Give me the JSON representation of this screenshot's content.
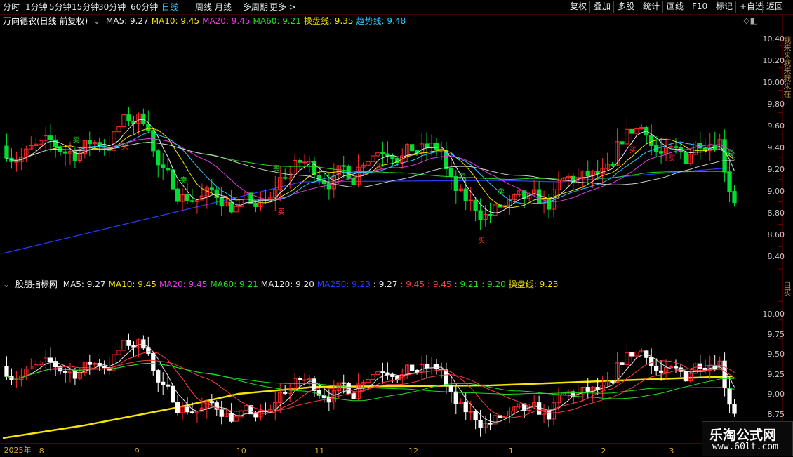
{
  "tabs": [
    "分时",
    "1分钟",
    "5分钟",
    "15分钟",
    "30分钟",
    "60分钟",
    "日线",
    "周线",
    "月线",
    "多周期",
    "更多 >"
  ],
  "active_tab": "日线",
  "right_buttons": [
    "复权",
    "叠加",
    "多股",
    "统计",
    "画线",
    "F10",
    "标记",
    "+自选",
    "返回"
  ],
  "main_panel": {
    "title": "万向德农(日线 前复权)",
    "indicators": [
      {
        "label": "MA5: 9.27",
        "color": "#e6e6e6"
      },
      {
        "label": "MA10: 9.45",
        "color": "#f5e400"
      },
      {
        "label": "MA20: 9.45",
        "color": "#e03ce0"
      },
      {
        "label": "MA60: 9.21",
        "color": "#22dd22"
      },
      {
        "label": "操盘线: 9.35",
        "color": "#f5e400"
      },
      {
        "label": "趋势线: 9.48",
        "color": "#33c3ff"
      }
    ],
    "price_labels": [
      "10.40",
      "10.20",
      "10.00",
      "9.80",
      "9.60",
      "9.40",
      "9.20",
      "9.00",
      "8.80",
      "8.60",
      "8.40"
    ],
    "side_text": "我来来我来我来在",
    "signals": [
      "买",
      "卖"
    ]
  },
  "sub_panel": {
    "title": "股朋指标网",
    "indicators": [
      {
        "label": "MA5: 9.27",
        "color": "#e6e6e6"
      },
      {
        "label": "MA10: 9.45",
        "color": "#f5e400"
      },
      {
        "label": "MA20: 9.45",
        "color": "#e03ce0"
      },
      {
        "label": "MA60: 9.21",
        "color": "#22dd22"
      },
      {
        "label": "MA120: 9.20",
        "color": "#e6e6e6"
      },
      {
        "label": "MA250: 9.23",
        "color": "#2040ff"
      },
      {
        "label": ": 9.27",
        "color": "#e6e6e6"
      },
      {
        "label": ": 9.45",
        "color": "#ff3b3b"
      },
      {
        "label": ": 9.45",
        "color": "#ff3b3b"
      },
      {
        "label": ": 9.21",
        "color": "#22dd22"
      },
      {
        "label": ": 9.20",
        "color": "#22dd22"
      },
      {
        "label": "操盘线: 9.23",
        "color": "#f5e400"
      }
    ],
    "price_labels": [
      "10.00",
      "9.75",
      "9.50",
      "9.25",
      "9.00",
      "8.75"
    ],
    "side_text": "自买"
  },
  "date_axis": [
    {
      "label": "2025年",
      "pos": 0.005
    },
    {
      "label": "8",
      "pos": 0.05
    },
    {
      "label": "9",
      "pos": 0.172
    },
    {
      "label": "10",
      "pos": 0.302
    },
    {
      "label": "11",
      "pos": 0.402
    },
    {
      "label": "12",
      "pos": 0.522
    },
    {
      "label": "1",
      "pos": 0.65
    },
    {
      "label": "2",
      "pos": 0.768
    },
    {
      "label": "3",
      "pos": 0.855
    }
  ],
  "brand": {
    "name": "乐淘公式网",
    "url": "www.60lt.com"
  },
  "colors": {
    "up": "#ff2a2a",
    "down": "#00dd33",
    "accent": "#33c3ff",
    "grid": "#5a0000"
  }
}
